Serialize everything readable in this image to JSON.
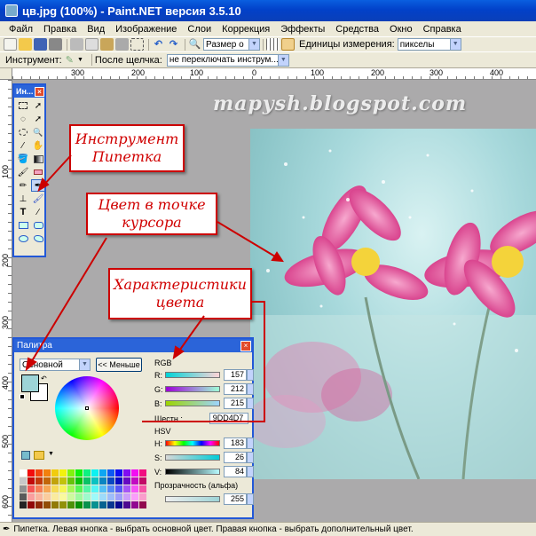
{
  "window": {
    "title": "цв.jpg (100%) - Paint.NET версия 3.5.10"
  },
  "menu": [
    "Файл",
    "Правка",
    "Вид",
    "Изображение",
    "Слои",
    "Коррекция",
    "Эффекты",
    "Средства",
    "Окно",
    "Справка"
  ],
  "toolbar": {
    "zoom_combo": "Размер о",
    "units_label": "Единицы измерения:",
    "units_value": "пикселы"
  },
  "toolbar2": {
    "tool_label": "Инструмент:",
    "after_click_label": "После щелчка:",
    "after_click_value": "не переключать инструм..."
  },
  "ruler_top": [
    "300",
    "200",
    "100",
    "0",
    "100",
    "200",
    "300",
    "400"
  ],
  "ruler_left": [
    "100",
    "200",
    "300",
    "400",
    "500",
    "600"
  ],
  "watermark": "mapysh.blogspot.com",
  "tools_panel": {
    "title": "Ин..."
  },
  "palette": {
    "title": "Палитра",
    "mode": "Основной",
    "less_button": "<< Меньше",
    "rgb_label": "RGB",
    "r_label": "R:",
    "r_value": "157",
    "g_label": "G:",
    "g_value": "212",
    "b_label": "B:",
    "b_value": "215",
    "hex_label": "Шестн.:",
    "hex_value": "9DD4D7",
    "hsv_label": "HSV",
    "h_label": "H:",
    "h_value": "183",
    "s_label": "S:",
    "s_value": "26",
    "v_label": "V:",
    "v_value": "84",
    "alpha_label": "Прозрачность (альфа)",
    "alpha_value": "255",
    "primary_color": "#9dd4d7"
  },
  "callouts": {
    "tool": "Инструмент Пипетка",
    "cursor_color": "Цвет в точке курсора",
    "color_props": "Характеристики цвета"
  },
  "status": "Пипетка. Левая кнопка - выбрать основной цвет. Правая кнопка - выбрать дополнительный цвет.",
  "colors": {
    "callout_border": "#cc0000",
    "callout_text": "#d00000",
    "title_blue": "#0a5fe0"
  }
}
